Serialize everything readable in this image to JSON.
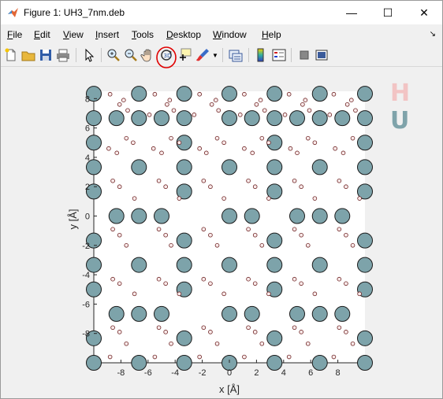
{
  "window": {
    "title": "Figure 1: UH3_7nm.deb",
    "minimize": "—",
    "maximize": "☐",
    "close": "✕"
  },
  "menu": {
    "items": [
      "File",
      "Edit",
      "View",
      "Insert",
      "Tools",
      "Desktop",
      "Window",
      "Help"
    ],
    "overflow": "↘"
  },
  "toolbar": {
    "buttons": [
      "new-figure",
      "open-file",
      "save",
      "print",
      "select",
      "zoom-in",
      "zoom-out",
      "pan",
      "rotate-3d",
      "data-cursor",
      "brush",
      "link-plot",
      "colorbar",
      "legend",
      "hide-plot-tools",
      "show-plot-tools"
    ],
    "highlighted": "rotate-3d",
    "highlight_color": "#e00000"
  },
  "chart_data": {
    "type": "scatter",
    "xlabel": "x [Å]",
    "ylabel": "y [Å]",
    "xlim": [
      -10,
      10
    ],
    "ylim": [
      -10,
      8.5
    ],
    "xticks": [
      -8,
      -6,
      -4,
      -2,
      0,
      2,
      4,
      6,
      8
    ],
    "yticks": [
      -8,
      -6,
      -4,
      -2,
      0,
      2,
      4,
      6,
      8
    ],
    "legend": [
      "H",
      "U"
    ],
    "colors": {
      "H": "#fbeaea",
      "U": "#7da3aa",
      "edge": "#1a1a1a",
      "legend_H": "#f2c4c4",
      "legend_U": "#7fa3aa"
    },
    "series": [
      {
        "name": "U",
        "points": [
          [
            -10,
            8.33
          ],
          [
            -6.67,
            8.33
          ],
          [
            -3.33,
            8.33
          ],
          [
            0,
            8.33
          ],
          [
            3.33,
            8.33
          ],
          [
            6.67,
            8.33
          ],
          [
            10,
            8.33
          ],
          [
            -10,
            6.67
          ],
          [
            -6.67,
            6.67
          ],
          [
            -3.33,
            6.67
          ],
          [
            0,
            6.67
          ],
          [
            3.33,
            6.67
          ],
          [
            6.67,
            6.67
          ],
          [
            10,
            6.67
          ],
          [
            -8.33,
            6.67
          ],
          [
            -5,
            6.67
          ],
          [
            1.67,
            6.67
          ],
          [
            5,
            6.67
          ],
          [
            8.33,
            6.67
          ],
          [
            -10,
            5
          ],
          [
            -3.33,
            5
          ],
          [
            3.33,
            5
          ],
          [
            10,
            5
          ],
          [
            -10,
            3.33
          ],
          [
            -6.67,
            3.33
          ],
          [
            -3.33,
            3.33
          ],
          [
            0,
            3.33
          ],
          [
            3.33,
            3.33
          ],
          [
            6.67,
            3.33
          ],
          [
            10,
            3.33
          ],
          [
            -10,
            1.67
          ],
          [
            -3.33,
            1.67
          ],
          [
            3.33,
            1.67
          ],
          [
            10,
            1.67
          ],
          [
            -8.33,
            0
          ],
          [
            -6.67,
            0
          ],
          [
            -5,
            0
          ],
          [
            0,
            0
          ],
          [
            1.67,
            0
          ],
          [
            5,
            0
          ],
          [
            6.67,
            0
          ],
          [
            8.33,
            0
          ],
          [
            -10,
            -1.67
          ],
          [
            -3.33,
            -1.67
          ],
          [
            3.33,
            -1.67
          ],
          [
            10,
            -1.67
          ],
          [
            -10,
            -3.33
          ],
          [
            -6.67,
            -3.33
          ],
          [
            -3.33,
            -3.33
          ],
          [
            0,
            -3.33
          ],
          [
            3.33,
            -3.33
          ],
          [
            6.67,
            -3.33
          ],
          [
            10,
            -3.33
          ],
          [
            -10,
            -5
          ],
          [
            -3.33,
            -5
          ],
          [
            3.33,
            -5
          ],
          [
            10,
            -5
          ],
          [
            -8.33,
            -6.67
          ],
          [
            -6.67,
            -6.67
          ],
          [
            -5,
            -6.67
          ],
          [
            0,
            -6.67
          ],
          [
            1.67,
            -6.67
          ],
          [
            5,
            -6.67
          ],
          [
            6.67,
            -6.67
          ],
          [
            8.33,
            -6.67
          ],
          [
            -10,
            -8.33
          ],
          [
            -3.33,
            -8.33
          ],
          [
            3.33,
            -8.33
          ],
          [
            10,
            -8.33
          ],
          [
            -10,
            -10
          ],
          [
            -6.67,
            -10
          ],
          [
            -3.33,
            -10
          ],
          [
            0,
            -10
          ],
          [
            3.33,
            -10
          ],
          [
            6.67,
            -10
          ],
          [
            10,
            -10
          ]
        ]
      },
      {
        "name": "H",
        "points": [
          [
            -8.8,
            8.3
          ],
          [
            -5.5,
            8.3
          ],
          [
            -2.2,
            8.3
          ],
          [
            1.1,
            8.3
          ],
          [
            4.4,
            8.3
          ],
          [
            7.7,
            8.3
          ],
          [
            -8.1,
            7.6
          ],
          [
            -7.5,
            7.2
          ],
          [
            -4.6,
            7.6
          ],
          [
            -4.1,
            7.2
          ],
          [
            -1.3,
            7.6
          ],
          [
            -0.8,
            7.2
          ],
          [
            2.0,
            7.6
          ],
          [
            2.6,
            7.2
          ],
          [
            5.4,
            7.6
          ],
          [
            5.9,
            7.2
          ],
          [
            8.7,
            7.6
          ],
          [
            9.3,
            7.2
          ],
          [
            -7.8,
            7.9
          ],
          [
            -4.4,
            7.9
          ],
          [
            -1.0,
            7.9
          ],
          [
            2.3,
            7.9
          ],
          [
            5.6,
            7.9
          ],
          [
            9.0,
            7.9
          ],
          [
            -5.9,
            6.9
          ],
          [
            -2.6,
            6.9
          ],
          [
            0.8,
            6.9
          ],
          [
            4.1,
            6.9
          ],
          [
            7.4,
            6.9
          ],
          [
            -8.9,
            4.6
          ],
          [
            -8.3,
            4.3
          ],
          [
            -5.6,
            4.6
          ],
          [
            -5.0,
            4.3
          ],
          [
            -2.2,
            4.6
          ],
          [
            -1.7,
            4.3
          ],
          [
            1.1,
            4.6
          ],
          [
            1.7,
            4.3
          ],
          [
            4.5,
            4.6
          ],
          [
            5.0,
            4.3
          ],
          [
            7.8,
            4.6
          ],
          [
            8.4,
            4.3
          ],
          [
            -7.6,
            5.3
          ],
          [
            -7.1,
            5.0
          ],
          [
            -4.3,
            5.3
          ],
          [
            -3.7,
            5.0
          ],
          [
            -0.9,
            5.3
          ],
          [
            -0.4,
            5.0
          ],
          [
            2.4,
            5.3
          ],
          [
            2.9,
            5.0
          ],
          [
            5.8,
            5.3
          ],
          [
            6.3,
            5.0
          ],
          [
            9.1,
            5.3
          ],
          [
            -8.6,
            2.4
          ],
          [
            -8.1,
            2.0
          ],
          [
            -5.2,
            2.4
          ],
          [
            -4.7,
            2.0
          ],
          [
            -1.9,
            2.4
          ],
          [
            -1.4,
            2.0
          ],
          [
            1.4,
            2.4
          ],
          [
            1.9,
            2.0
          ],
          [
            4.8,
            2.4
          ],
          [
            5.3,
            2.0
          ],
          [
            8.1,
            2.4
          ],
          [
            8.6,
            2.0
          ],
          [
            -7.0,
            1.2
          ],
          [
            -3.7,
            1.2
          ],
          [
            -0.4,
            1.2
          ],
          [
            2.9,
            1.2
          ],
          [
            6.3,
            1.2
          ],
          [
            9.6,
            1.2
          ],
          [
            -8.6,
            -0.9
          ],
          [
            -8.1,
            -1.3
          ],
          [
            -5.2,
            -0.9
          ],
          [
            -4.7,
            -1.3
          ],
          [
            -1.9,
            -0.9
          ],
          [
            -1.4,
            -1.3
          ],
          [
            1.4,
            -0.9
          ],
          [
            1.9,
            -1.3
          ],
          [
            4.8,
            -0.9
          ],
          [
            5.3,
            -1.3
          ],
          [
            8.1,
            -0.9
          ],
          [
            8.6,
            -1.3
          ],
          [
            -7.6,
            -2.0
          ],
          [
            -4.3,
            -2.0
          ],
          [
            -0.9,
            -2.0
          ],
          [
            2.4,
            -2.0
          ],
          [
            5.8,
            -2.0
          ],
          [
            9.1,
            -2.0
          ],
          [
            -8.6,
            -4.3
          ],
          [
            -8.1,
            -4.6
          ],
          [
            -5.2,
            -4.3
          ],
          [
            -4.7,
            -4.6
          ],
          [
            -1.9,
            -4.3
          ],
          [
            -1.4,
            -4.6
          ],
          [
            1.4,
            -4.3
          ],
          [
            1.9,
            -4.6
          ],
          [
            4.8,
            -4.3
          ],
          [
            5.3,
            -4.6
          ],
          [
            8.1,
            -4.3
          ],
          [
            8.6,
            -4.6
          ],
          [
            -7.0,
            -5.3
          ],
          [
            -3.7,
            -5.3
          ],
          [
            -0.4,
            -5.3
          ],
          [
            2.9,
            -5.3
          ],
          [
            6.3,
            -5.3
          ],
          [
            9.6,
            -5.3
          ],
          [
            -8.6,
            -7.6
          ],
          [
            -8.1,
            -7.9
          ],
          [
            -5.2,
            -7.6
          ],
          [
            -4.7,
            -7.9
          ],
          [
            -1.9,
            -7.6
          ],
          [
            -1.4,
            -7.9
          ],
          [
            1.4,
            -7.6
          ],
          [
            1.9,
            -7.9
          ],
          [
            4.8,
            -7.6
          ],
          [
            5.3,
            -7.9
          ],
          [
            8.1,
            -7.6
          ],
          [
            8.6,
            -7.9
          ],
          [
            -7.6,
            -8.7
          ],
          [
            -4.3,
            -8.7
          ],
          [
            -0.9,
            -8.7
          ],
          [
            2.4,
            -8.7
          ],
          [
            5.8,
            -8.7
          ],
          [
            9.1,
            -8.7
          ],
          [
            -8.8,
            -9.6
          ],
          [
            -5.5,
            -9.6
          ],
          [
            -2.2,
            -9.6
          ],
          [
            1.1,
            -9.6
          ],
          [
            4.4,
            -9.6
          ],
          [
            7.7,
            -9.6
          ]
        ]
      }
    ],
    "grid": false,
    "legend_placement": "top-right outside"
  }
}
